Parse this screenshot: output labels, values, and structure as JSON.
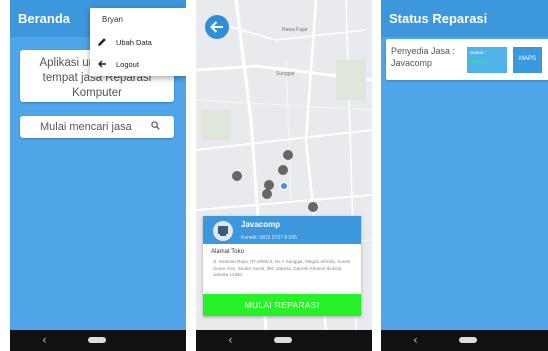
{
  "home": {
    "title": "Beranda",
    "hero_text": "Aplikasi untuk mencari tempat jasa Reparasi Komputer",
    "search_button_label": "Mulai mencari jasa",
    "menu": {
      "user_name": "Bryan",
      "items": [
        {
          "label": "Ubah Data",
          "icon": "pencil-icon"
        },
        {
          "label": "Logout",
          "icon": "arrow-left-icon"
        }
      ]
    }
  },
  "map_screen": {
    "map_labels": [
      "Rawa Fajar",
      "Sunggal"
    ],
    "store": {
      "name": "Javacomp",
      "contact": "Kontak: 0815 9737 8 556",
      "address_label": "Alamat Toko",
      "address": "Jl. Sentosa Raya, RT.5/RW.5, No 7 Sunggal, Megah Afrinda, Sunter Sumit, Kec. Sunter Sumit, DKI Jakarta, Daerah Khusus Ibukota Jakarta 14350"
    },
    "action_button_label": "MULAI REPARASI"
  },
  "status_screen": {
    "title": "Status Reparasi",
    "provider_text": "Penyedia Jasa : Javacomp",
    "status_label": "Status :",
    "status_value": "Diterima",
    "maps_button_label": "MAPS"
  },
  "colors": {
    "primary": "#3d97dc",
    "background": "#4ea6e8",
    "action_green": "#27f227",
    "nav_bar": "#111111"
  }
}
